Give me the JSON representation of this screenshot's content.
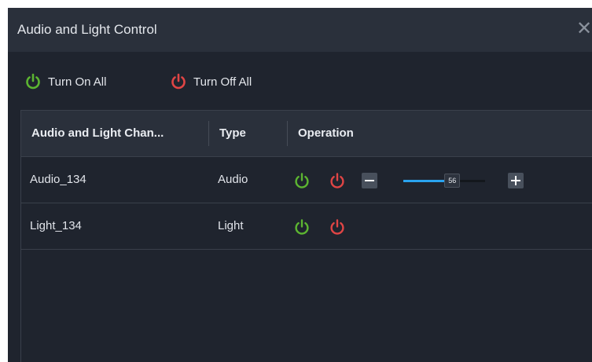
{
  "dialog": {
    "title": "Audio and Light Control",
    "close_glyph": "✕"
  },
  "toolbar": {
    "turn_on_all": "Turn On All",
    "turn_off_all": "Turn Off All"
  },
  "table": {
    "columns": [
      "Audio and Light Chan...",
      "Type",
      "Operation"
    ],
    "rows": [
      {
        "channel": "Audio_134",
        "type": "Audio",
        "volume": 56
      },
      {
        "channel": "Light_134",
        "type": "Light"
      }
    ]
  },
  "colors": {
    "on_green": "#5cb531",
    "off_red": "#e04545",
    "slider_blue": "#2aa3ef"
  },
  "icons": {
    "on": "power-on-icon",
    "off": "power-off-icon",
    "decrease": "minus-icon",
    "increase": "plus-icon"
  }
}
